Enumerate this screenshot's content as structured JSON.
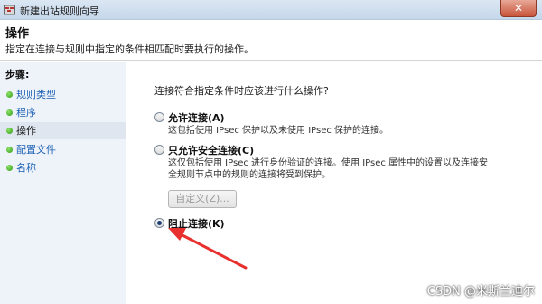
{
  "window": {
    "title": "新建出站规则向导",
    "close_glyph": "✕"
  },
  "header": {
    "title": "操作",
    "description": "指定在连接与规则中指定的条件相匹配时要执行的操作。"
  },
  "steps": {
    "title": "步骤:",
    "items": [
      {
        "label": "规则类型",
        "active": false
      },
      {
        "label": "程序",
        "active": false
      },
      {
        "label": "操作",
        "active": true
      },
      {
        "label": "配置文件",
        "active": false
      },
      {
        "label": "名称",
        "active": false
      }
    ]
  },
  "main": {
    "question": "连接符合指定条件时应该进行什么操作?",
    "options": [
      {
        "label": "允许连接(A)",
        "checked": false,
        "desc": [
          "这包括使用 IPsec 保护以及未使用 IPsec 保护的连接。"
        ]
      },
      {
        "label": "只允许安全连接(C)",
        "checked": false,
        "desc": [
          "这仅包括使用 IPsec 进行身份验证的连接。使用 IPsec 属性中的设置以及连接安",
          "全规则节点中的规则的连接将受到保护。"
        ]
      },
      {
        "label": "阻止连接(K)",
        "checked": true,
        "desc": []
      }
    ],
    "custom_button": "自定义(Z)..."
  },
  "watermark": "CSDN @米斯兰迪尔",
  "colors": {
    "accent_link": "#1a5fb4",
    "arrow": "#e8312e",
    "step_dot": "#2f9a14"
  }
}
